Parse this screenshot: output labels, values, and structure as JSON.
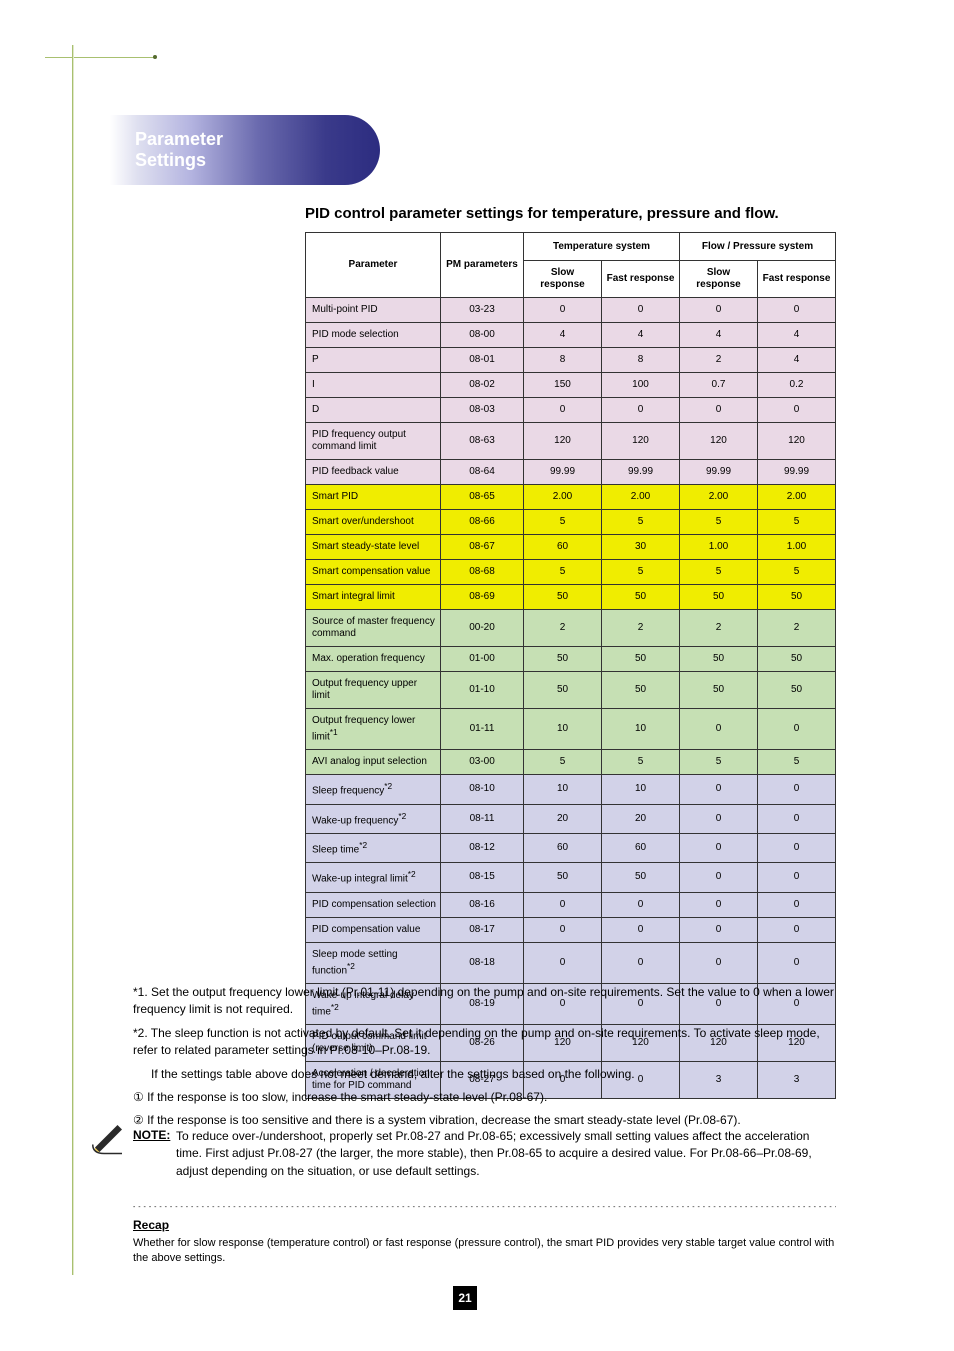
{
  "header": {
    "pill_label": "Parameter\nSettings"
  },
  "section_title": "PID control parameter settings for temperature, pressure and flow.",
  "chart_data": {
    "type": "table",
    "title": "PID control parameter settings for temperature, pressure and flow.",
    "columns_top": [
      "Parameter",
      "PM parameters",
      "Temperature system",
      "Flow / Pressure system"
    ],
    "columns_sub": [
      "",
      "",
      "Slow response",
      "Fast response",
      "Slow response",
      "Fast response"
    ],
    "groups": [
      {
        "color": "pink",
        "rows": [
          {
            "label": "Multi-point PID",
            "pm": "03-23",
            "t_slow": "0",
            "t_fast": "0",
            "f_slow": "0",
            "f_fast": "0"
          },
          {
            "label": "PID mode selection",
            "pm": "08-00",
            "t_slow": "4",
            "t_fast": "4",
            "f_slow": "4",
            "f_fast": "4"
          },
          {
            "label": "P",
            "pm": "08-01",
            "t_slow": "8",
            "t_fast": "8",
            "f_slow": "2",
            "f_fast": "4"
          },
          {
            "label": "I",
            "pm": "08-02",
            "t_slow": "150",
            "t_fast": "100",
            "f_slow": "0.7",
            "f_fast": "0.2"
          },
          {
            "label": "D",
            "pm": "08-03",
            "t_slow": "0",
            "t_fast": "0",
            "f_slow": "0",
            "f_fast": "0"
          },
          {
            "label": "PID frequency output command limit",
            "pm": "08-63",
            "t_slow": "120",
            "t_fast": "120",
            "f_slow": "120",
            "f_fast": "120"
          },
          {
            "label": "PID feedback value",
            "pm": "08-64",
            "t_slow": "99.99",
            "t_fast": "99.99",
            "f_slow": "99.99",
            "f_fast": "99.99"
          }
        ]
      },
      {
        "color": "yellow",
        "rows": [
          {
            "label": "Smart PID",
            "pm": "08-65",
            "t_slow": "2.00",
            "t_fast": "2.00",
            "f_slow": "2.00",
            "f_fast": "2.00"
          },
          {
            "label": "Smart over/undershoot",
            "pm": "08-66",
            "t_slow": "5",
            "t_fast": "5",
            "f_slow": "5",
            "f_fast": "5"
          },
          {
            "label": "Smart steady-state level",
            "pm": "08-67",
            "t_slow": "60",
            "t_fast": "30",
            "f_slow": "1.00",
            "f_fast": "1.00"
          },
          {
            "label": "Smart compensation value",
            "pm": "08-68",
            "t_slow": "5",
            "t_fast": "5",
            "f_slow": "5",
            "f_fast": "5"
          },
          {
            "label": "Smart integral limit",
            "pm": "08-69",
            "t_slow": "50",
            "t_fast": "50",
            "f_slow": "50",
            "f_fast": "50"
          }
        ]
      },
      {
        "color": "green",
        "rows": [
          {
            "label": "Source of master frequency command",
            "pm": "00-20",
            "t_slow": "2",
            "t_fast": "2",
            "f_slow": "2",
            "f_fast": "2"
          },
          {
            "label": "Max. operation frequency",
            "pm": "01-00",
            "t_slow": "50",
            "t_fast": "50",
            "f_slow": "50",
            "f_fast": "50"
          },
          {
            "label": "Output frequency upper limit",
            "pm": "01-10",
            "t_slow": "50",
            "t_fast": "50",
            "f_slow": "50",
            "f_fast": "50"
          },
          {
            "label": "Output frequency lower limit*¹",
            "pm": "01-11",
            "t_slow": "10",
            "t_fast": "10",
            "f_slow": "0",
            "f_fast": "0"
          },
          {
            "label": "AVI analog input selection",
            "pm": "03-00",
            "t_slow": "5",
            "t_fast": "5",
            "f_slow": "5",
            "f_fast": "5"
          }
        ]
      },
      {
        "color": "purple",
        "rows": [
          {
            "label": "Sleep frequency*²",
            "pm": "08-10",
            "t_slow": "10",
            "t_fast": "10",
            "f_slow": "0",
            "f_fast": "0"
          },
          {
            "label": "Wake-up frequency*²",
            "pm": "08-11",
            "t_slow": "20",
            "t_fast": "20",
            "f_slow": "0",
            "f_fast": "0"
          },
          {
            "label": "Sleep time*²",
            "pm": "08-12",
            "t_slow": "60",
            "t_fast": "60",
            "f_slow": "0",
            "f_fast": "0"
          },
          {
            "label": "Wake-up integral limit*²",
            "pm": "08-15",
            "t_slow": "50",
            "t_fast": "50",
            "f_slow": "0",
            "f_fast": "0"
          },
          {
            "label": "PID compensation selection",
            "pm": "08-16",
            "t_slow": "0",
            "t_fast": "0",
            "f_slow": "0",
            "f_fast": "0"
          },
          {
            "label": "PID compensation value",
            "pm": "08-17",
            "t_slow": "0",
            "t_fast": "0",
            "f_slow": "0",
            "f_fast": "0"
          },
          {
            "label": "Sleep mode setting function*²",
            "pm": "08-18",
            "t_slow": "0",
            "t_fast": "0",
            "f_slow": "0",
            "f_fast": "0"
          },
          {
            "label": "Wake-up integral delay time*²",
            "pm": "08-19",
            "t_slow": "0",
            "t_fast": "0",
            "f_slow": "0",
            "f_fast": "0"
          },
          {
            "label": "PID output command limit (reverse limit)",
            "pm": "08-26",
            "t_slow": "120",
            "t_fast": "120",
            "f_slow": "120",
            "f_fast": "120"
          },
          {
            "label": "Acceleration / deceleration time for PID command",
            "pm": "08-27",
            "t_slow": "0",
            "t_fast": "0",
            "f_slow": "3",
            "f_fast": "3"
          }
        ]
      }
    ]
  },
  "notes": {
    "p1": "*1. Set the output frequency lower limit (Pr.01-11) depending on the pump and on-site requirements. Set the value to 0 when a lower frequency limit is not required.",
    "p2": "*2. The sleep function is not activated by default. Set it depending on the pump and on-site requirements. To activate sleep mode, refer to related parameter settings in Pr.08-10–Pr.08-19.",
    "p3": "If the settings table above does not meet demand, alter the settings based on the following.",
    "bullet1": "If the response is too slow, increase the smart steady-state level (Pr.08-67).",
    "bullet2": "If the response is too sensitive and there is a system vibration, decrease the smart steady-state level (Pr.08-67)."
  },
  "callout": {
    "note_label": "NOTE:",
    "note_body_l1": "To reduce over-/undershoot, properly set Pr.08-27 and Pr.08-65; excessively small setting values affect the",
    "note_body_l2": "acceleration time. First adjust Pr.08-27 (the larger, the more stable), then Pr.08-65 to acquire a desired value. For",
    "note_body_l3": "Pr.08-66–Pr.08-69, adjust depending on the situation, or use default settings."
  },
  "recap": {
    "title": "Recap",
    "text": "Whether for slow response (temperature control) or fast response (pressure control), the smart PID provides very stable target value control with the above settings."
  },
  "page_number": "21"
}
